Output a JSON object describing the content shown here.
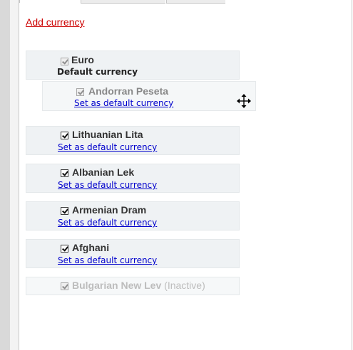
{
  "add_currency_label": "Add currency",
  "set_default_label": "Set as default currency",
  "default_label": "Default currency",
  "currencies": [
    {
      "name": "Euro",
      "checked": true,
      "is_default": true
    },
    {
      "name": "Andorran Peseta",
      "checked": true,
      "dragging": true
    },
    {
      "name": "Lithuanian Lita",
      "checked": true
    },
    {
      "name": "Albanian Lek",
      "checked": true
    },
    {
      "name": "Armenian Dram",
      "checked": true
    },
    {
      "name": "Afghani",
      "checked": true
    },
    {
      "name": "Bulgarian New Lev",
      "checked": true,
      "status": "(Inactive)"
    }
  ],
  "icons": {
    "remove": "remove-icon",
    "move": "move-cursor-icon"
  },
  "colors": {
    "link": "#0000cc",
    "add_link": "#cc0000",
    "row_bg": "#eff2f4"
  }
}
